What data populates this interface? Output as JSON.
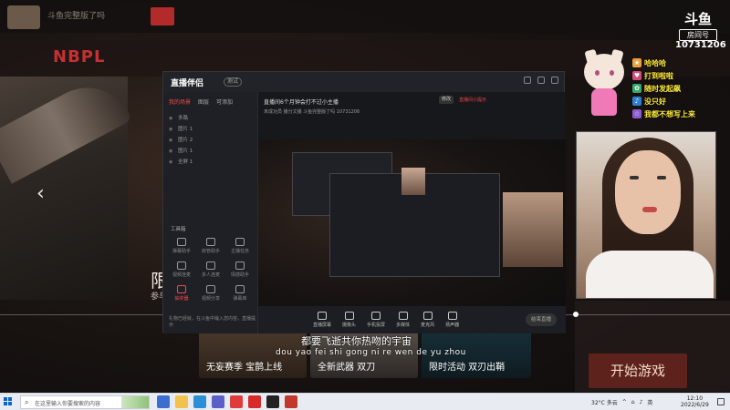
{
  "background_app": {
    "username": "斗鱼完整版了吗",
    "logo": "NBPL",
    "left_title": "限",
    "left_sub": "参与",
    "start_button": "开始游戏",
    "arrow": "‹",
    "cards": [
      {
        "label": "无妄赛季 宝鹊上线"
      },
      {
        "label": "全新武器 双刀"
      },
      {
        "label": "限时活动 双刃出鞘"
      }
    ],
    "lyric": "都要飞逝共你热吻的宇宙",
    "lyric_pinyin": "dou yao fei shi gong ni re wen de yu zhou"
  },
  "douyu": {
    "logo": "斗鱼",
    "room_label": "房间号",
    "room_number": "10731206"
  },
  "chat_messages": [
    {
      "text": "哈哈哈",
      "icon_color": "#e9a23b"
    },
    {
      "text": "打到啦啦",
      "icon_color": "#d14d7a"
    },
    {
      "text": "随时发起飙",
      "icon_color": "#3aa86b"
    },
    {
      "text": "没只好",
      "icon_color": "#2d7fd3"
    },
    {
      "text": "我都不想写上来",
      "icon_color": "#8a5acf"
    }
  ],
  "stream_assistant": {
    "title": "直播伴侣",
    "badge": "测试",
    "tabs": [
      "我的场景",
      "图层",
      "可添加"
    ],
    "scenes": [
      "多路",
      "图片 1",
      "图片 2",
      "图片 1",
      "全屏 1"
    ],
    "tools_label": "工具箱",
    "tools": [
      {
        "label": "弹幕助手",
        "hot": false
      },
      {
        "label": "房管助手",
        "hot": false
      },
      {
        "label": "主播任务",
        "hot": false
      },
      {
        "label": "视频连麦",
        "hot": false
      },
      {
        "label": "多人连麦",
        "hot": false
      },
      {
        "label": "情感助手",
        "hot": false
      },
      {
        "label": "抽奖器",
        "hot": true
      },
      {
        "label": "视频分享",
        "hot": false
      },
      {
        "label": "弹幕库",
        "hot": false
      }
    ],
    "footer_note": "礼物已经就，在斗鱼中输入您内容，直播提示",
    "room_title": "直播间6个月钟会打不过小主播",
    "room_sub": "未成功员  播分文播   斗鱼完整版了吗  10731206",
    "edit_label": "修改",
    "red_link": "直播间小提示",
    "controls": [
      "直播屏幕",
      "摄像头",
      "手机投屏",
      "多媒体",
      "麦克风",
      "扬声器"
    ],
    "go_live": "结束直播"
  },
  "taskbar": {
    "search_placeholder": "在这里输入你要搜索的内容",
    "weather": "32°C 多云",
    "time": "12:10",
    "date": "2022/6/29",
    "lang": "英"
  }
}
